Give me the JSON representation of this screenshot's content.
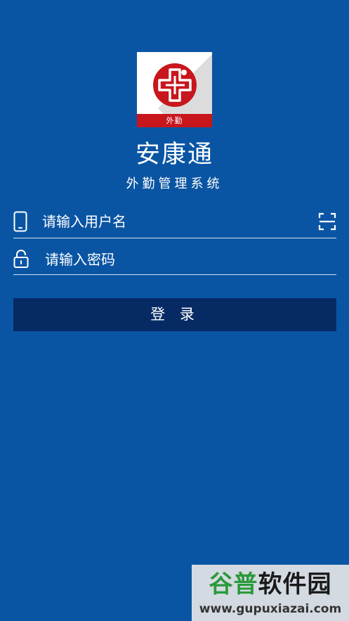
{
  "app": {
    "logo_badge": "外勤",
    "title": "安康通",
    "subtitle": "外勤管理系统"
  },
  "login_form": {
    "username": {
      "placeholder": "请输入用户名",
      "value": "",
      "icon": "phone-icon",
      "action_icon": "scan-icon"
    },
    "password": {
      "placeholder": "请输入密码",
      "value": "",
      "icon": "lock-icon"
    },
    "submit_label": "登 录"
  },
  "watermark": {
    "title_green": "谷普",
    "title_dark": "软件园",
    "url": "www.gupuxiazai.com"
  },
  "colors": {
    "background": "#0a55a3",
    "button": "#062a63",
    "logo_red": "#c8161d",
    "watermark_green": "#2a9a3a"
  }
}
